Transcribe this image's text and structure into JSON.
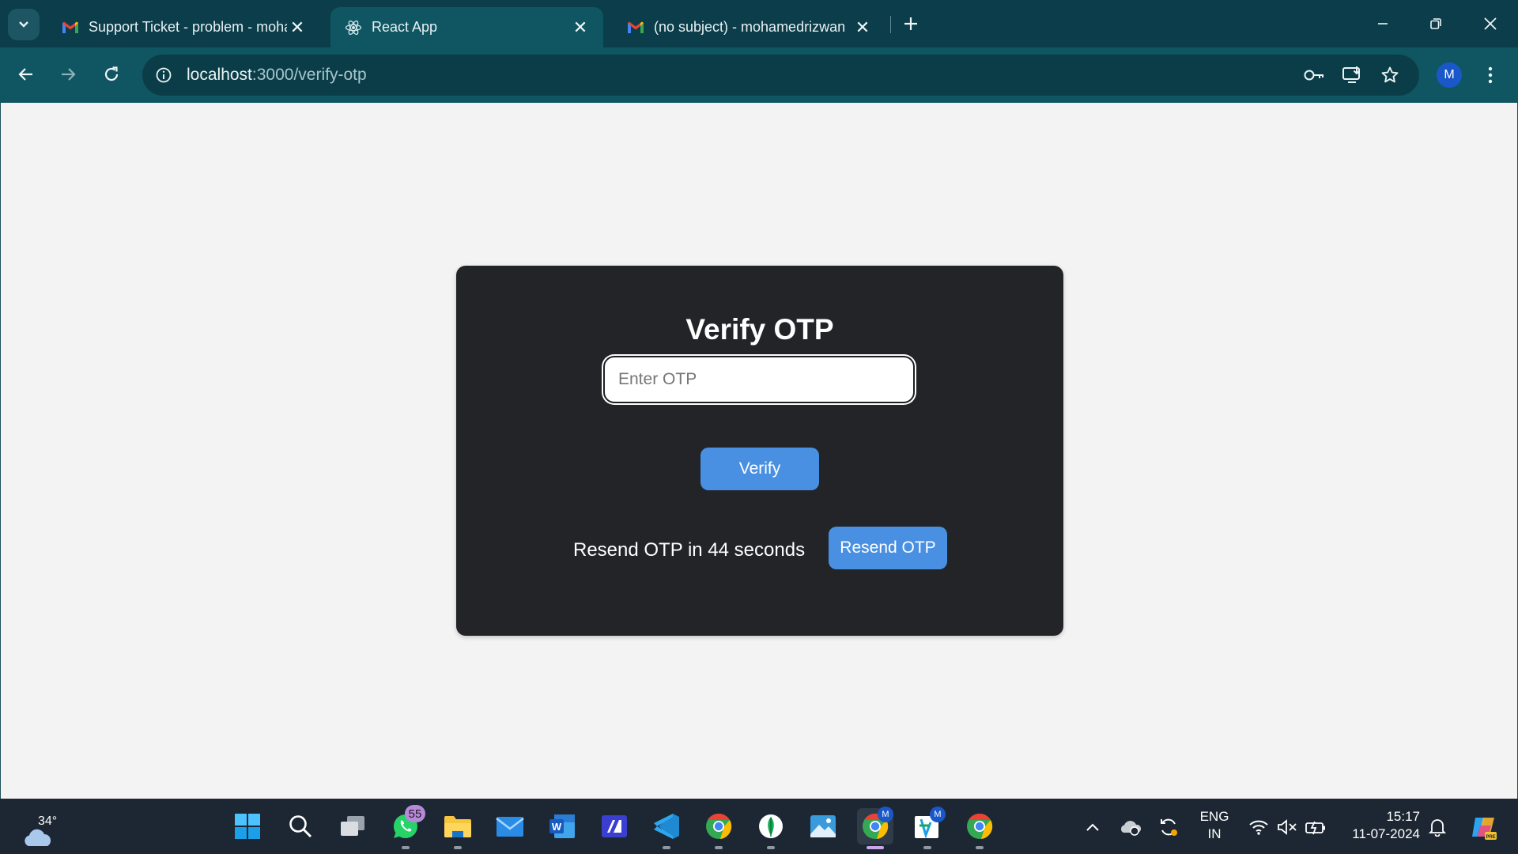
{
  "browser": {
    "tabs": [
      {
        "title": "Support Ticket - problem - mohamedrizwan",
        "favicon": "gmail-icon",
        "active": false
      },
      {
        "title": "React App",
        "favicon": "react-icon",
        "active": true
      },
      {
        "title": "(no subject) - mohamedrizwan",
        "favicon": "gmail-icon",
        "active": false
      }
    ],
    "url_host": "localhost",
    "url_path": ":3000/verify-otp",
    "profile_initial": "M"
  },
  "page": {
    "title": "Verify OTP",
    "otp_placeholder": "Enter OTP",
    "otp_value": "",
    "verify_label": "Verify",
    "resend_text": "Resend OTP in 44 seconds",
    "resend_label": "Resend OTP"
  },
  "taskbar": {
    "weather_temp": "34°",
    "whatsapp_badge": "55",
    "chrome_profile_badge": "M",
    "mongo_profile_badge": "M",
    "lang_line1": "ENG",
    "lang_line2": "IN",
    "time": "15:17",
    "date": "11-07-2024"
  },
  "colors": {
    "accent": "#4a90e2",
    "card_bg": "#222428",
    "chrome_frame": "#0b3d4a",
    "chrome_toolbar": "#0f5662"
  }
}
